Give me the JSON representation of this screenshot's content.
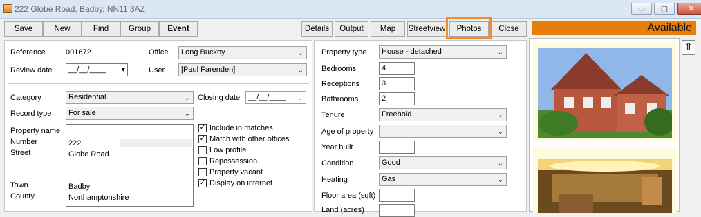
{
  "window": {
    "title": "222 Globe Road, Badby, NN11 3AZ",
    "min": "▭",
    "max": "▢",
    "close": "✕"
  },
  "toolbar": {
    "save": "Save",
    "new": "New",
    "find": "Find",
    "group": "Group",
    "event": "Event",
    "details": "Details",
    "output": "Output",
    "map": "Map",
    "streetview": "Streetview",
    "photos": "Photos",
    "close": "Close"
  },
  "status": "Available",
  "left": {
    "reference_label": "Reference",
    "reference_value": "001672",
    "review_label": "Review date",
    "review_value": "__/__/____",
    "office_label": "Office",
    "office_value": "Long Buckby",
    "user_label": "User",
    "user_value": "[Paul Farenden]",
    "category_label": "Category",
    "category_value": "Residential",
    "closing_label": "Closing date",
    "closing_value": "__/__/____",
    "record_label": "Record type",
    "record_value": "For sale",
    "name_label": "Property name",
    "number_label": "Number",
    "street_label": "Street",
    "town_label": "Town",
    "county_label": "County",
    "number_value": "222",
    "street_value": "Globe Road",
    "town_value": "Badby",
    "county_value": "Northamptonshire"
  },
  "checks": [
    {
      "label": "Include in matches",
      "checked": true
    },
    {
      "label": "Match with other offices",
      "checked": true
    },
    {
      "label": "Low profile",
      "checked": false
    },
    {
      "label": "Repossession",
      "checked": false
    },
    {
      "label": "Property vacant",
      "checked": false
    },
    {
      "label": "Display on internet",
      "checked": true
    }
  ],
  "mid": {
    "type_label": "Property type",
    "type_value": "House - detached",
    "bed_label": "Bedrooms",
    "bed_value": "4",
    "rec_label": "Receptions",
    "rec_value": "3",
    "bath_label": "Bathrooms",
    "bath_value": "2",
    "tenure_label": "Tenure",
    "tenure_value": "Freehold",
    "age_label": "Age of property",
    "age_value": "",
    "year_label": "Year built",
    "year_value": "",
    "cond_label": "Condition",
    "cond_value": "Good",
    "heat_label": "Heating",
    "heat_value": "Gas",
    "floor_label": "Floor area (sqft)",
    "floor_value": "",
    "land_label": "Land (acres)"
  },
  "icons": {
    "check": "✓",
    "chev": "⌄",
    "updown": "⇧"
  }
}
